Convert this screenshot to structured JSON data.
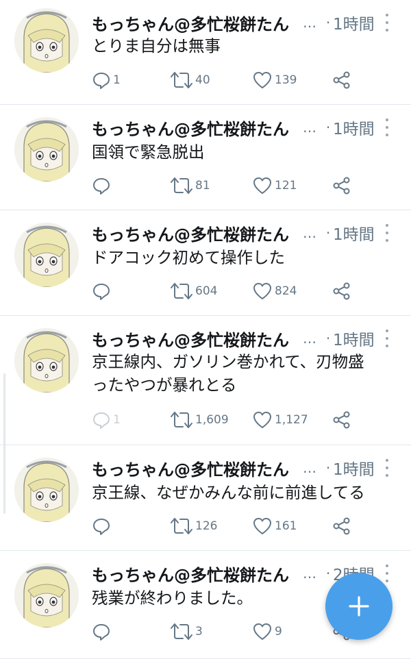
{
  "tweets": [
    {
      "name": "もっちゃん@多忙桜餅たん",
      "time": "1時間",
      "lines": [
        "とりま自分は無事"
      ],
      "replies": "1",
      "retweets": "40",
      "likes": "139"
    },
    {
      "name": "もっちゃん@多忙桜餅たん",
      "time": "1時間",
      "lines": [
        "国領で緊急脱出"
      ],
      "replies": "",
      "retweets": "81",
      "likes": "121"
    },
    {
      "name": "もっちゃん@多忙桜餅たん",
      "time": "1時間",
      "lines": [
        "ドアコック初めて操作した"
      ],
      "replies": "",
      "retweets": "604",
      "likes": "824"
    },
    {
      "name": "もっちゃん@多忙桜餅たん",
      "time": "1時間",
      "lines": [
        "京王線内、ガソリン巻かれて、刃物盛",
        "ったやつが暴れとる"
      ],
      "replies": "1",
      "retweets": "1,609",
      "likes": "1,127"
    },
    {
      "name": "もっちゃん@多忙桜餅たん",
      "time": "1時間",
      "lines": [
        "京王線、なぜかみんな前に前進してる"
      ],
      "replies": "",
      "retweets": "126",
      "likes": "161"
    },
    {
      "name": "もっちゃん@多忙桜餅たん",
      "time": "2時間",
      "lines": [
        "残業が終わりました。"
      ],
      "replies": "",
      "retweets": "3",
      "likes": "9"
    }
  ],
  "ellipsis": "…",
  "separator": "·",
  "compose_button": {
    "icon": "plus-icon"
  },
  "colors": {
    "accent": "#4a9fea",
    "secondary_text": "#657786",
    "primary_text": "#14171a",
    "divider": "#e1e8ed"
  }
}
